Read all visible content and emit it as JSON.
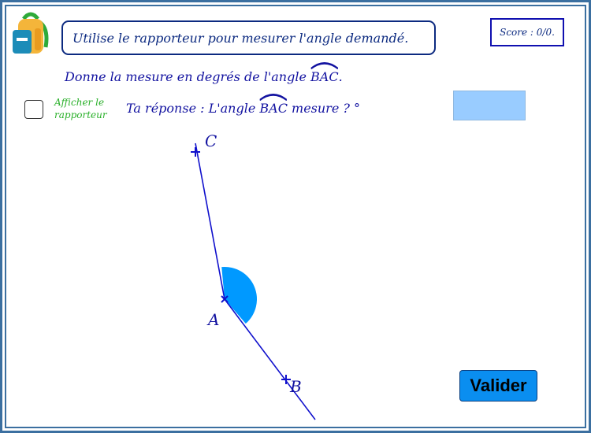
{
  "instruction": "Utilise le rapporteur pour mesurer l'angle demandé.",
  "score": "Score : 0/0.",
  "question": {
    "prefix": "Donne la mesure en degrés de l'angle ",
    "angle": "BAC",
    "suffix": "."
  },
  "protractor_toggle": {
    "line1": "Afficher le",
    "line2": "rapporteur",
    "checked": false
  },
  "answer": {
    "prefix": "Ta réponse : L'angle ",
    "angle": "BAC",
    "suffix": " mesure ? °",
    "value": ""
  },
  "points": {
    "A": "A",
    "B": "B",
    "C": "C"
  },
  "validate_label": "Valider",
  "colors": {
    "frame": "#3b6fa0",
    "text": "#1212a0",
    "angle_fill": "#0099ff",
    "input_bg": "#99ccff",
    "button": "#0a8ef0",
    "toggle_label": "#2ab02a"
  },
  "icons": {
    "backpack": "backpack-icon"
  }
}
